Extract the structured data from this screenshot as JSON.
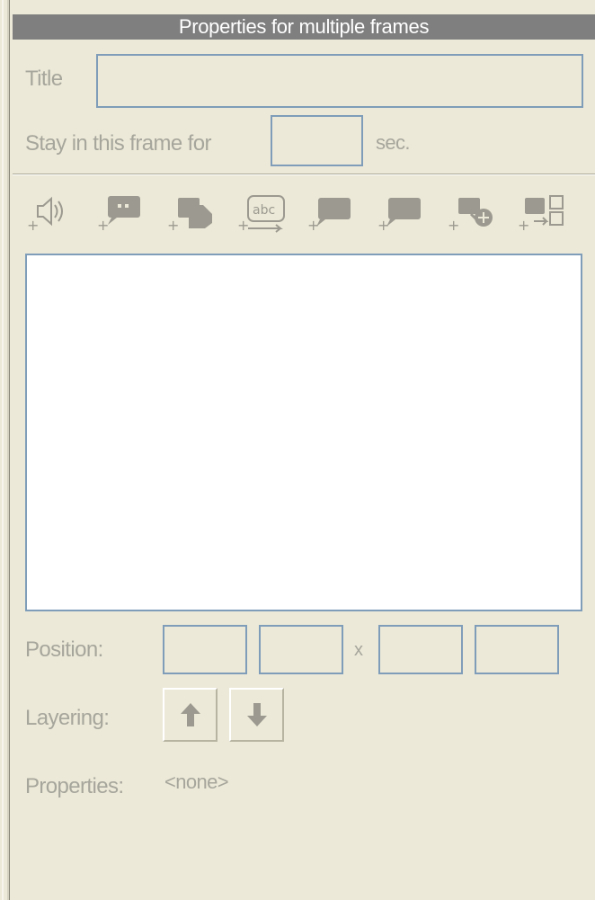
{
  "panel": {
    "title": "Properties for multiple frames"
  },
  "frame": {
    "title_label": "Title",
    "title_value": "",
    "stay_label": "Stay in this frame for",
    "stay_value": "",
    "stay_unit": "sec."
  },
  "toolbar": {
    "items": [
      {
        "icon": "add-sound-icon"
      },
      {
        "icon": "add-callout-icon"
      },
      {
        "icon": "add-highlight-icon"
      },
      {
        "icon": "add-text-icon"
      },
      {
        "icon": "add-box-icon"
      },
      {
        "icon": "add-box-alt-icon"
      },
      {
        "icon": "add-link-icon"
      },
      {
        "icon": "add-action-icon"
      }
    ]
  },
  "object": {
    "position_label": "Position:",
    "position_separator": "x",
    "position_values": [
      "",
      "",
      "",
      ""
    ],
    "layering_label": "Layering:",
    "properties_label": "Properties:",
    "properties_value": "<none>"
  },
  "colors": {
    "background": "#ece9d8",
    "title_bar": "#7f7f7f",
    "field_border": "#7f9db9",
    "disabled_text": "#a7a69c",
    "icon_gray": "#9c9a90"
  }
}
